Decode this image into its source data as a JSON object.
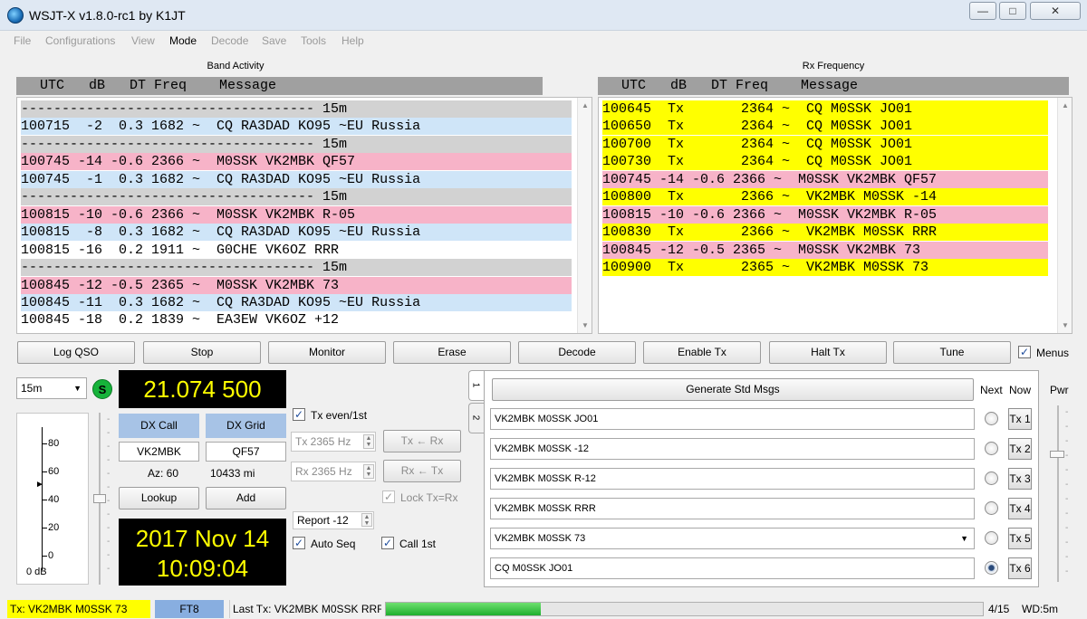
{
  "window": {
    "title": "WSJT-X   v1.8.0-rc1   by K1JT",
    "controls": {
      "minimize": "—",
      "maximize": "□",
      "close": "✕"
    }
  },
  "menu": [
    {
      "label": "File",
      "active": false
    },
    {
      "label": "Configurations",
      "active": false
    },
    {
      "label": "View",
      "active": false
    },
    {
      "label": "Mode",
      "active": true
    },
    {
      "label": "Decode",
      "active": false
    },
    {
      "label": "Save",
      "active": false
    },
    {
      "label": "Tools",
      "active": false
    },
    {
      "label": "Help",
      "active": false
    }
  ],
  "band_activity": {
    "title": "Band Activity",
    "header": "  UTC   dB   DT Freq    Message",
    "lines": [
      {
        "text": "------------------------------------ 15m",
        "color": "#d2d2d2"
      },
      {
        "text": "100715  -2  0.3 1682 ~  CQ RA3DAD KO95 ~EU Russia",
        "color": "#cfe5f8"
      },
      {
        "text": "------------------------------------ 15m",
        "color": "#d2d2d2"
      },
      {
        "text": "100745 -14 -0.6 2366 ~  M0SSK VK2MBK QF57",
        "color": "#f7b3c8"
      },
      {
        "text": "100745  -1  0.3 1682 ~  CQ RA3DAD KO95 ~EU Russia",
        "color": "#cfe5f8"
      },
      {
        "text": "------------------------------------ 15m",
        "color": "#d2d2d2"
      },
      {
        "text": "100815 -10 -0.6 2366 ~  M0SSK VK2MBK R-05",
        "color": "#f7b3c8"
      },
      {
        "text": "100815  -8  0.3 1682 ~  CQ RA3DAD KO95 ~EU Russia",
        "color": "#cfe5f8"
      },
      {
        "text": "100815 -16  0.2 1911 ~  G0CHE VK6OZ RRR",
        "color": "#ffffff"
      },
      {
        "text": "------------------------------------ 15m",
        "color": "#d2d2d2"
      },
      {
        "text": "100845 -12 -0.5 2365 ~  M0SSK VK2MBK 73",
        "color": "#f7b3c8"
      },
      {
        "text": "100845 -11  0.3 1682 ~  CQ RA3DAD KO95 ~EU Russia",
        "color": "#cfe5f8"
      },
      {
        "text": "100845 -18  0.2 1839 ~  EA3EW VK6OZ +12",
        "color": "#ffffff"
      }
    ]
  },
  "rx_frequency": {
    "title": "Rx Frequency",
    "header": "  UTC   dB   DT Freq    Message",
    "lines": [
      {
        "text": "100645  Tx       2364 ~  CQ M0SSK JO01",
        "color": "#ffff00"
      },
      {
        "text": "100650  Tx       2364 ~  CQ M0SSK JO01",
        "color": "#ffff00"
      },
      {
        "text": "100700  Tx       2364 ~  CQ M0SSK JO01",
        "color": "#ffff00"
      },
      {
        "text": "100730  Tx       2364 ~  CQ M0SSK JO01",
        "color": "#ffff00"
      },
      {
        "text": "100745 -14 -0.6 2366 ~  M0SSK VK2MBK QF57",
        "color": "#f7b3c8"
      },
      {
        "text": "100800  Tx       2366 ~  VK2MBK M0SSK -14",
        "color": "#ffff00"
      },
      {
        "text": "100815 -10 -0.6 2366 ~  M0SSK VK2MBK R-05",
        "color": "#f7b3c8"
      },
      {
        "text": "100830  Tx       2366 ~  VK2MBK M0SSK RRR",
        "color": "#ffff00"
      },
      {
        "text": "100845 -12 -0.5 2365 ~  M0SSK VK2MBK 73",
        "color": "#f7b3c8"
      },
      {
        "text": "100900  Tx       2365 ~  VK2MBK M0SSK 73",
        "color": "#ffff00"
      }
    ]
  },
  "buttons": {
    "log_qso": "Log QSO",
    "stop": "Stop",
    "monitor": "Monitor",
    "erase": "Erase",
    "decode": "Decode",
    "enable_tx": "Enable Tx",
    "halt_tx": "Halt Tx",
    "tune": "Tune",
    "menus": "Menus",
    "menus_checked": true
  },
  "left": {
    "band": "15m",
    "s_badge": "S",
    "dial_freq": "21.074 500",
    "meter_ticks": [
      "80",
      "60",
      "40",
      "20",
      "0"
    ],
    "meter_unit": "0 dB",
    "dx_call_label": "DX Call",
    "dx_grid_label": "DX Grid",
    "dx_call": "VK2MBK",
    "dx_grid": "QF57",
    "az": "Az: 60",
    "dist": "10433 mi",
    "lookup": "Lookup",
    "add": "Add",
    "date": "2017 Nov 14",
    "time": "10:09:04"
  },
  "center": {
    "tx_even": "Tx even/1st",
    "tx_hz": "Tx  2365  Hz",
    "rx_hz": "Rx  2365  Hz",
    "tx_from_rx": "Tx ← Rx",
    "rx_from_tx": "Rx ← Tx",
    "lock": "Lock Tx=Rx",
    "report": "Report -12",
    "auto_seq": "Auto Seq",
    "call_1st": "Call 1st"
  },
  "messages": {
    "tab1": "1",
    "tab2": "2",
    "generate": "Generate Std Msgs",
    "next": "Next",
    "now": "Now",
    "tx": [
      {
        "text": "VK2MBK M0SSK JO01",
        "btn": "Tx 1"
      },
      {
        "text": "VK2MBK M0SSK -12",
        "btn": "Tx 2"
      },
      {
        "text": "VK2MBK M0SSK R-12",
        "btn": "Tx 3"
      },
      {
        "text": "VK2MBK M0SSK RRR",
        "btn": "Tx 4"
      },
      {
        "text": "VK2MBK M0SSK 73",
        "btn": "Tx 5"
      },
      {
        "text": "CQ M0SSK JO01",
        "btn": "Tx 6"
      }
    ],
    "selected_next": 6,
    "pwr": "Pwr"
  },
  "status": {
    "tx": "Tx: VK2MBK M0SSK 73",
    "mode": "FT8",
    "last_tx": "Last Tx: VK2MBK M0SSK RRR",
    "progress": 0.26,
    "count": "4/15",
    "wd": "WD:5m"
  },
  "colors": {
    "yellow": "#ffff00",
    "pink": "#f7b3c8",
    "blue": "#cfe5f8",
    "separator": "#d2d2d2",
    "display_bg": "#000000",
    "display_fg": "#ffff00",
    "progress": "#2fbf3a"
  }
}
